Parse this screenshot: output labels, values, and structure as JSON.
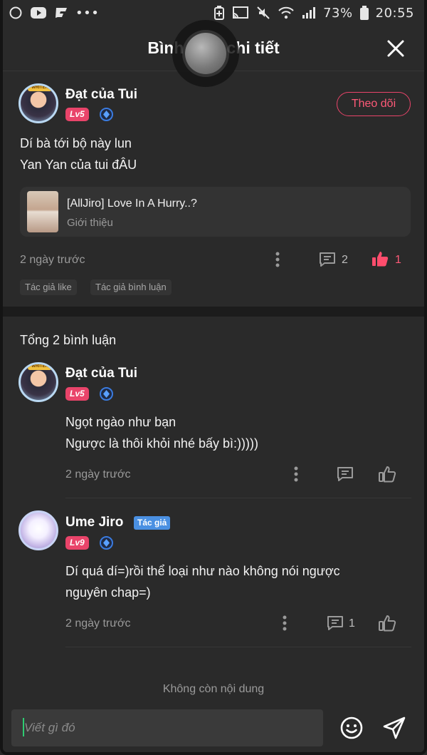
{
  "status_bar": {
    "battery": "73%",
    "time": "20:55",
    "dots": "•••"
  },
  "header": {
    "title": "Bình luận chi tiết"
  },
  "main_comment": {
    "username": "Đạt của Tui",
    "level": "Lv5",
    "follow_label": "Theo dõi",
    "lines": [
      "Dí bà tới bộ này lun",
      "Yan Yan của tui đÂU"
    ],
    "link_card": {
      "title": "[AllJiro] Love In A Hurry..?",
      "subtitle": "Giới thiệu"
    },
    "time": "2 ngày trước",
    "reply_count": "2",
    "like_count": "1",
    "chips": [
      "Tác giả like",
      "Tác giả bình luận"
    ]
  },
  "total_label": "Tổng 2 bình luận",
  "replies": [
    {
      "username": "Đạt của Tui",
      "level": "Lv5",
      "lines": [
        "Ngọt ngào như bạn",
        "Ngược là thôi khỏi nhé bấy bì:)))))"
      ],
      "time": "2 ngày trước"
    },
    {
      "username": "Ume Jiro",
      "author_badge": "Tác giả",
      "level": "Lv9",
      "lines": [
        "Dí quá dí=)rồi thể loại như nào không nói ngược",
        "nguyên chap=)"
      ],
      "time": "2 ngày trước",
      "reply_count": "1"
    }
  ],
  "no_more_label": "Không còn nội dung",
  "composer": {
    "placeholder": "Viết gì đó"
  },
  "colors": {
    "background": "#2a2a2a",
    "accent_pink": "#e9446a",
    "author_blue": "#4a90e2",
    "muted_text": "#9a9a9a"
  },
  "icons": [
    "circle-icon",
    "youtube-icon",
    "flipboard-icon",
    "battery-saver-icon",
    "cast-icon",
    "mute-icon",
    "wifi-icon",
    "signal-icon",
    "battery-icon",
    "close-icon",
    "gem-icon",
    "more-vertical-icon",
    "comment-icon",
    "thumbs-up-icon",
    "emoji-icon",
    "send-icon"
  ]
}
